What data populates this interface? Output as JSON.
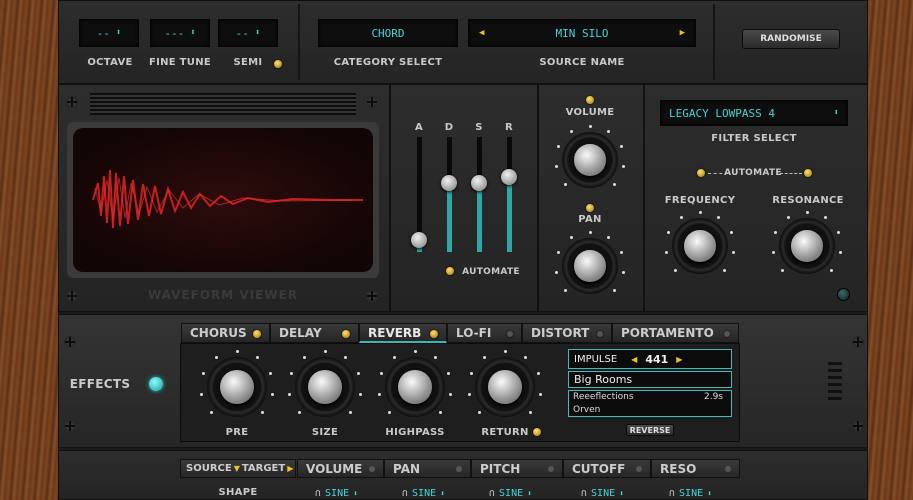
{
  "top": {
    "octave": {
      "value": "--",
      "label": "OCTAVE"
    },
    "fine_tune": {
      "value": "---",
      "label": "FINE TUNE"
    },
    "semi": {
      "value": "--",
      "label": "SEMI"
    },
    "category": {
      "value": "CHORD",
      "label": "CATEGORY SELECT"
    },
    "source": {
      "value": "MIN SILO",
      "label": "SOURCE NAME"
    },
    "randomise_label": "RANDOMISE"
  },
  "waveform": {
    "label": "WAVEFORM VIEWER"
  },
  "envelope": {
    "labels": [
      "A",
      "D",
      "S",
      "R"
    ],
    "levels": [
      0.1,
      0.6,
      0.6,
      0.65
    ],
    "automate_label": "AUTOMATE"
  },
  "volume_label": "VOLUME",
  "pan_label": "PAN",
  "filter": {
    "value": "LEGACY LOWPASS 4",
    "label": "FILTER SELECT",
    "automate_label": "AUTOMATE",
    "frequency_label": "FREQUENCY",
    "resonance_label": "RESONANCE"
  },
  "effects": {
    "label": "EFFECTS",
    "tabs": [
      {
        "label": "CHORUS"
      },
      {
        "label": "DELAY"
      },
      {
        "label": "REVERB"
      },
      {
        "label": "LO-FI"
      },
      {
        "label": "DISTORT"
      },
      {
        "label": "PORTAMENTO"
      }
    ],
    "active_tab": "REVERB",
    "knobs": [
      {
        "label": "PRE"
      },
      {
        "label": "SIZE"
      },
      {
        "label": "HIGHPASS"
      },
      {
        "label": "RETURN"
      }
    ],
    "impulse": {
      "label": "IMPULSE",
      "value": "441"
    },
    "impulse_name": "Big Rooms",
    "list": [
      {
        "name": "Reeeflections",
        "value": "2.9s"
      },
      {
        "name": "Orven",
        "value": ""
      }
    ],
    "reverse_label": "REVERSE"
  },
  "mod": {
    "source_label": "SOURCE",
    "target_label": "TARGET",
    "tabs": [
      {
        "label": "VOLUME"
      },
      {
        "label": "PAN"
      },
      {
        "label": "PITCH"
      },
      {
        "label": "CUTOFF"
      },
      {
        "label": "RESO"
      }
    ],
    "shape_label": "SHAPE",
    "shapes": [
      "SINE",
      "SINE",
      "SINE",
      "SINE",
      "SINE"
    ]
  },
  "colors": {
    "accent": "#3ab7b3",
    "lcd_text": "#46d4d6",
    "led": "#f0c020",
    "wave": "#c42020"
  }
}
